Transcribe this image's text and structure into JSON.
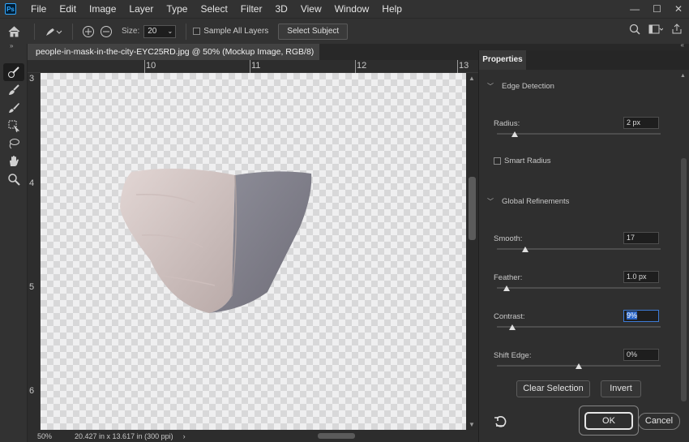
{
  "menubar": {
    "logo": "Ps",
    "items": [
      "File",
      "Edit",
      "Image",
      "Layer",
      "Type",
      "Select",
      "Filter",
      "3D",
      "View",
      "Window",
      "Help"
    ],
    "controls": [
      "—",
      "☐",
      "✕"
    ]
  },
  "options": {
    "size_label": "Size:",
    "size_value": "20",
    "sample_all_layers": "Sample All Layers",
    "select_subject": "Select Subject"
  },
  "document": {
    "tab_title": "people-in-mask-in-the-city-EYC25RD.jpg @ 50% (Mockup Image, RGB/8) *",
    "tab_close": "×",
    "ruler_h": [
      "10",
      "11",
      "12",
      "13"
    ],
    "ruler_v": [
      "3",
      "4",
      "5",
      "6"
    ],
    "zoom": "50%",
    "doc_size": "20.427 in x 13.617 in (300 ppi)",
    "status_arrow": "›"
  },
  "properties": {
    "tab_label": "Properties",
    "edge_detection": "Edge Detection",
    "radius_label": "Radius:",
    "radius_value": "2 px",
    "radius_fraction": 0.1,
    "smart_radius": "Smart Radius",
    "global_refinements": "Global Refinements",
    "smooth_label": "Smooth:",
    "smooth_value": "17",
    "smooth_fraction": 0.17,
    "feather_label": "Feather:",
    "feather_value": "1.0 px",
    "feather_fraction": 0.01,
    "contrast_label": "Contrast:",
    "contrast_value": "9%",
    "contrast_fraction": 0.09,
    "shift_edge_label": "Shift Edge:",
    "shift_edge_value": "0%",
    "shift_edge_fraction": 0.5,
    "clear_selection": "Clear Selection",
    "invert": "Invert",
    "ok": "OK",
    "cancel": "Cancel"
  },
  "colors": {
    "accent_blue": "#31a8ff",
    "focus_blue": "#2a66c9",
    "panel_bg": "#2f2f2f"
  }
}
